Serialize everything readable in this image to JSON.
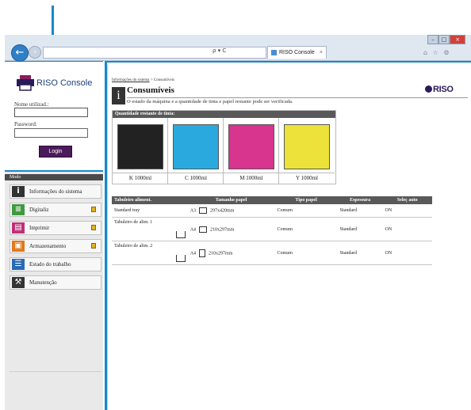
{
  "browser": {
    "back_glyph": "←",
    "address_controls": "ρ ▾ C",
    "tab_title": "RISO Console",
    "tab_close": "×",
    "window_buttons": {
      "minimize": "–",
      "maximize": "□",
      "close": "×"
    },
    "toolbar_icons": "⌂ ☆ ⚙"
  },
  "login": {
    "logo_text": "RISO Console",
    "username_label": "Nome utilizad.:",
    "username_value": "",
    "password_label": "Password:",
    "password_value": "",
    "login_button": "Login"
  },
  "menu": {
    "header": "Modo",
    "items": [
      {
        "label": "Informações do sistema",
        "icon": "info-icon",
        "glyph": "i",
        "color": "#333333",
        "locked": false
      },
      {
        "label": "Digitaliz",
        "icon": "scan-icon",
        "glyph": "≡",
        "color": "#3f9a3f",
        "locked": true
      },
      {
        "label": "Imprimir",
        "icon": "print-icon",
        "glyph": "▤",
        "color": "#c0307a",
        "locked": true
      },
      {
        "label": "Armazenamento",
        "icon": "storage-icon",
        "glyph": "▣",
        "color": "#e07a1c",
        "locked": true
      },
      {
        "label": "Estado do trabalho",
        "icon": "job-status-icon",
        "glyph": "☰",
        "color": "#2a6bb5",
        "locked": false
      },
      {
        "label": "Manutenção",
        "icon": "maintenance-icon",
        "glyph": "⚒",
        "color": "#333333",
        "locked": false
      }
    ]
  },
  "content": {
    "breadcrumb_link": "Informações do sistema",
    "breadcrumb_rest": " > Consumíveis",
    "page_icon_glyph": "i",
    "title": "Consumíveis",
    "description": "O estado da máquina e a quantidade de tinta e papel restante pode ser verificada.",
    "brand": "RISO"
  },
  "ink": {
    "header": "Quantidade restante de tinta:",
    "cartridges": [
      {
        "label": "K 1000ml",
        "color": "#222222"
      },
      {
        "label": "C 1000ml",
        "color": "#2aa9df"
      },
      {
        "label": "M 1000ml",
        "color": "#d8358f"
      },
      {
        "label": "Y 1000ml",
        "color": "#ece23a"
      }
    ]
  },
  "trays": {
    "columns": [
      "Tabuleiro aliment.",
      "Tamanho papel",
      "Tipo papel",
      "Espessura",
      "Seleç auto"
    ],
    "rows": [
      {
        "name": "Standard tray",
        "size": "A3",
        "dims": "297x420mm",
        "orientation": "landscape",
        "type": "Comum",
        "thickness": "Standard",
        "auto": "ON",
        "tray_icon": false
      },
      {
        "name": "Tabuleiro de alim. 1",
        "size": "A4",
        "dims": "210x297mm",
        "orientation": "landscape",
        "type": "Comum",
        "thickness": "Standard",
        "auto": "ON",
        "tray_icon": true
      },
      {
        "name": "Tabuleiro de alim. 2",
        "size": "A4",
        "dims": "210x297mm",
        "orientation": "portrait",
        "type": "Comum",
        "thickness": "Standard",
        "auto": "ON",
        "tray_icon": true
      }
    ]
  },
  "colors": {
    "callout": "#1689c9",
    "header_dark": "#595959",
    "login_button": "#4b1a5a"
  }
}
